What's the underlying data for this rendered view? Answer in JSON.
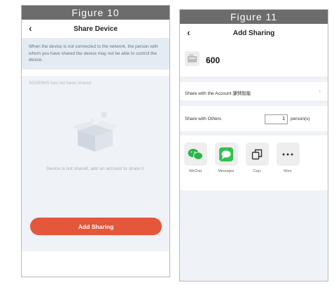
{
  "figure_left": {
    "label": "Figure 10",
    "header_title": "Share Device",
    "notice": "When the device is not connected to the network, the person with whom you have shared the device may not be able to control the device.",
    "not_shared_text": "SG300MS has not been shared",
    "empty_text": "Device is not shared, add an account to share it.",
    "add_button": "Add Sharing"
  },
  "figure_right": {
    "label": "Figure 11",
    "header_title": "Add Sharing",
    "device_name": "600",
    "account_row": "Share with the Account 謙錡智能",
    "others_row": "Share with Others",
    "person_count": "1",
    "person_unit": "person(s)",
    "share_options": [
      {
        "label": "WeChat",
        "icon": "wechat-icon"
      },
      {
        "label": "Messages",
        "icon": "messages-icon"
      },
      {
        "label": "Copy",
        "icon": "copy-icon"
      },
      {
        "label": "More",
        "icon": "more-icon"
      }
    ]
  },
  "colors": {
    "accent": "#e4573b",
    "figure_bar": "#6c6c6c",
    "notice_bg": "#e4ebf3",
    "wechat_green": "#29b44a",
    "messages_green": "#33c14e"
  }
}
